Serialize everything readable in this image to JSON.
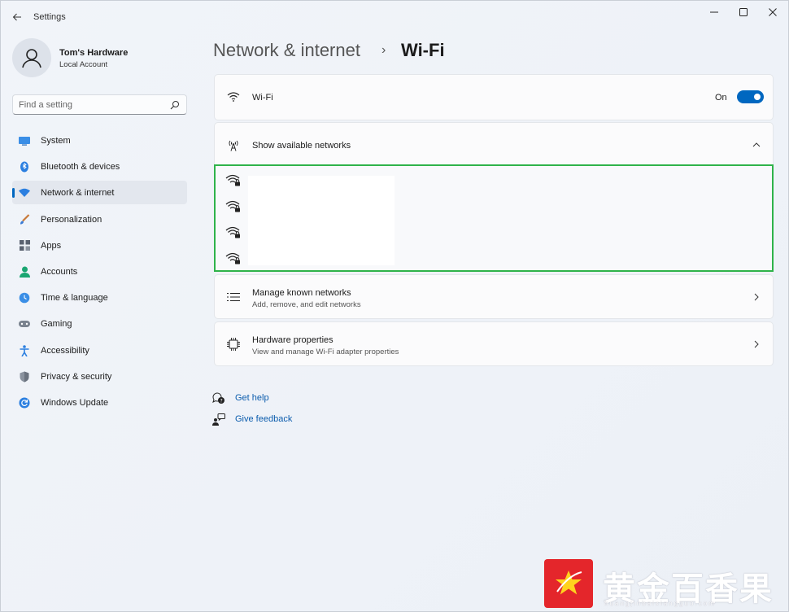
{
  "window": {
    "title": "Settings"
  },
  "profile": {
    "name": "Tom's Hardware",
    "account_type": "Local Account"
  },
  "search": {
    "placeholder": "Find a setting"
  },
  "sidebar": {
    "items": [
      {
        "label": "System",
        "icon": "monitor-icon"
      },
      {
        "label": "Bluetooth & devices",
        "icon": "bluetooth-icon"
      },
      {
        "label": "Network & internet",
        "icon": "wifi-icon",
        "active": true
      },
      {
        "label": "Personalization",
        "icon": "paintbrush-icon"
      },
      {
        "label": "Apps",
        "icon": "apps-icon"
      },
      {
        "label": "Accounts",
        "icon": "person-icon"
      },
      {
        "label": "Time & language",
        "icon": "globe-clock-icon"
      },
      {
        "label": "Gaming",
        "icon": "gamepad-icon"
      },
      {
        "label": "Accessibility",
        "icon": "accessibility-icon"
      },
      {
        "label": "Privacy & security",
        "icon": "shield-icon"
      },
      {
        "label": "Windows Update",
        "icon": "refresh-icon"
      }
    ]
  },
  "breadcrumb": {
    "parent": "Network & internet",
    "separator": "›",
    "current": "Wi-Fi"
  },
  "wifi_card": {
    "title": "Wi-Fi",
    "toggle_state": "On",
    "toggle_on": true
  },
  "networks_card": {
    "title": "Show available networks",
    "network_count": 4
  },
  "known_networks": {
    "title": "Manage known networks",
    "subtitle": "Add, remove, and edit networks"
  },
  "hardware": {
    "title": "Hardware properties",
    "subtitle": "View and manage Wi-Fi adapter properties"
  },
  "links": {
    "help": "Get help",
    "feedback": "Give feedback"
  },
  "watermark": {
    "text": "黄金百香果",
    "sub": "huangjinbaixiangguo.com"
  },
  "colors": {
    "accent": "#0067c0",
    "highlight_border": "#2fb34a",
    "watermark_red": "#e4262b"
  }
}
